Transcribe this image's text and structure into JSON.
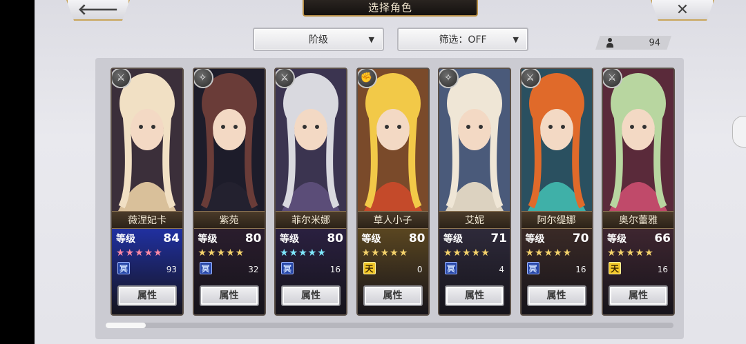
{
  "header": {
    "back_glyph": "🡐",
    "title": "选择角色",
    "close_glyph": "✕"
  },
  "filters": {
    "rank_label": "阶级",
    "filter_label": "筛选：OFF",
    "arrow_glyph": "▼"
  },
  "roster_count": "94",
  "icons": {
    "back": "back-arrow-icon",
    "close": "close-icon",
    "person": "person-icon",
    "class": "class-emblem-icon"
  },
  "colors": {
    "accent_gold": "#c9a55a",
    "star_pink": "#ff8aa6",
    "star_gold": "#f5d36b",
    "star_cyan": "#7fe9ff"
  },
  "characters": [
    {
      "name": "薇涅妃卡",
      "level_label": "等级",
      "level": "84",
      "stars": "★★★★★",
      "star_color": "pink",
      "badge": "冥",
      "badge_color": "blue",
      "count": "93",
      "attr_label": "属性",
      "class_glyph": "⚔"
    },
    {
      "name": "紫苑",
      "level_label": "等级",
      "level": "80",
      "stars": "★★★★★",
      "star_color": "gold",
      "badge": "冥",
      "badge_color": "blue",
      "count": "32",
      "attr_label": "属性",
      "class_glyph": "✧"
    },
    {
      "name": "菲尔米娜",
      "level_label": "等级",
      "level": "80",
      "stars": "★★★★★",
      "star_color": "cyan",
      "badge": "冥",
      "badge_color": "blue",
      "count": "16",
      "attr_label": "属性",
      "class_glyph": "⚔"
    },
    {
      "name": "草人小子",
      "level_label": "等级",
      "level": "80",
      "stars": "★★★★★",
      "star_color": "gold",
      "badge": "天",
      "badge_color": "gold",
      "count": "0",
      "attr_label": "属性",
      "class_glyph": "✊"
    },
    {
      "name": "艾妮",
      "level_label": "等级",
      "level": "71",
      "stars": "★★★★★",
      "star_color": "gold",
      "badge": "冥",
      "badge_color": "blue",
      "count": "4",
      "attr_label": "属性",
      "class_glyph": "✧"
    },
    {
      "name": "阿尔缇娜",
      "level_label": "等级",
      "level": "70",
      "stars": "★★★★★",
      "star_color": "gold",
      "badge": "冥",
      "badge_color": "blue",
      "count": "16",
      "attr_label": "属性",
      "class_glyph": "⚔"
    },
    {
      "name": "奥尔蕾雅",
      "level_label": "等级",
      "level": "66",
      "stars": "★★★★★",
      "star_color": "gold",
      "badge": "天",
      "badge_color": "gold",
      "count": "16",
      "attr_label": "属性",
      "class_glyph": "⚔"
    }
  ]
}
